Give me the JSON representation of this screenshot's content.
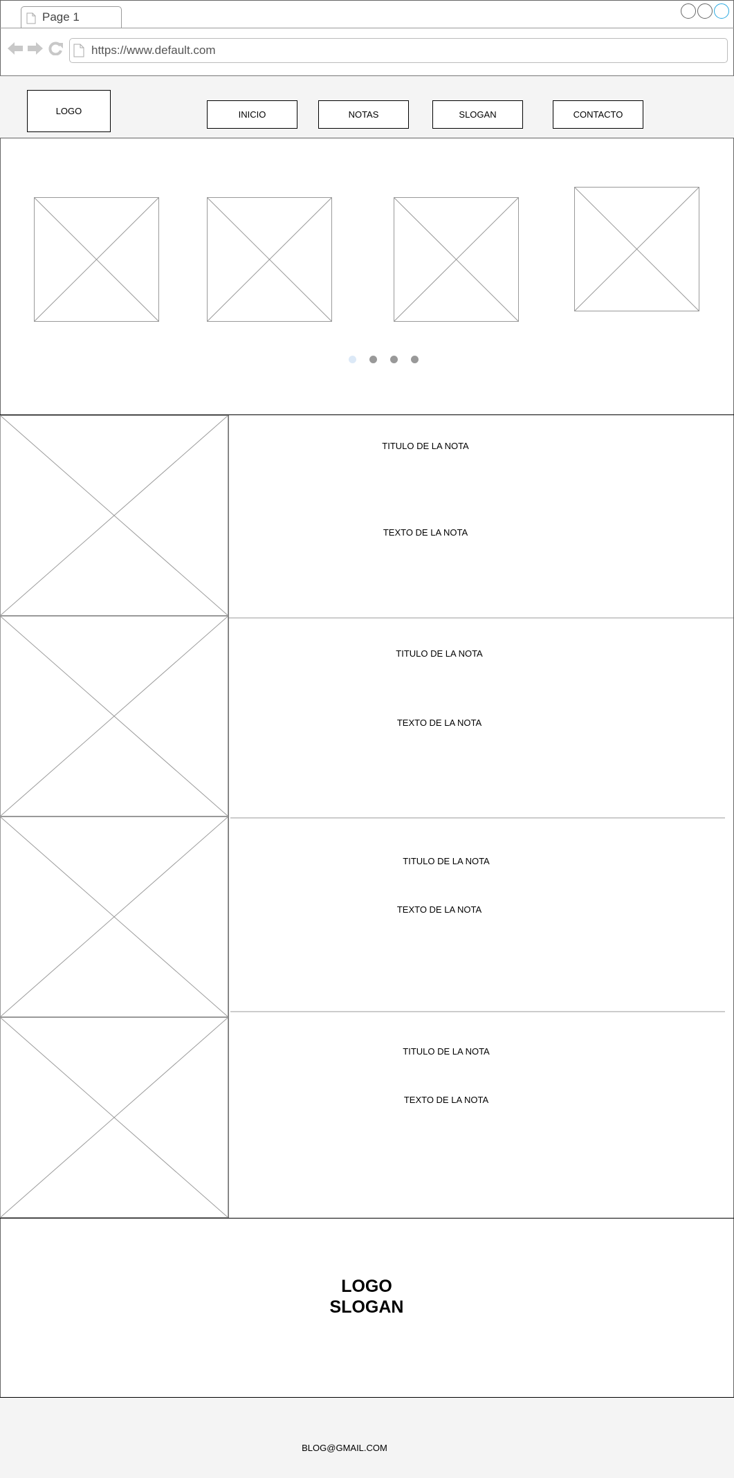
{
  "browser": {
    "tab_title": "Page 1",
    "url": "https://www.default.com"
  },
  "header": {
    "logo": "LOGO",
    "nav": [
      "INICIO",
      "NOTAS",
      "SLOGAN",
      "CONTACTO"
    ]
  },
  "carousel": {
    "slides": 4,
    "active_indicator": 1,
    "indicator_count": 4
  },
  "notes": [
    {
      "title": "TITULO DE LA NOTA",
      "text": "TEXTO DE LA NOTA"
    },
    {
      "title": "TITULO DE LA NOTA",
      "text": "TEXTO DE LA NOTA"
    },
    {
      "title": "TITULO DE LA NOTA",
      "text": "TEXTO DE LA NOTA"
    },
    {
      "title": "TITULO DE LA NOTA",
      "text": "TEXTO DE LA NOTA"
    }
  ],
  "brand": {
    "logo": "LOGO",
    "slogan": "SLOGAN"
  },
  "footer": {
    "email": "BLOG@GMAIL.COM"
  },
  "colors": {
    "active_dot": "#dce9f7",
    "inactive_dot": "#999999",
    "header_bg": "#f4f4f4",
    "maximize_button": "#29a8e0"
  }
}
